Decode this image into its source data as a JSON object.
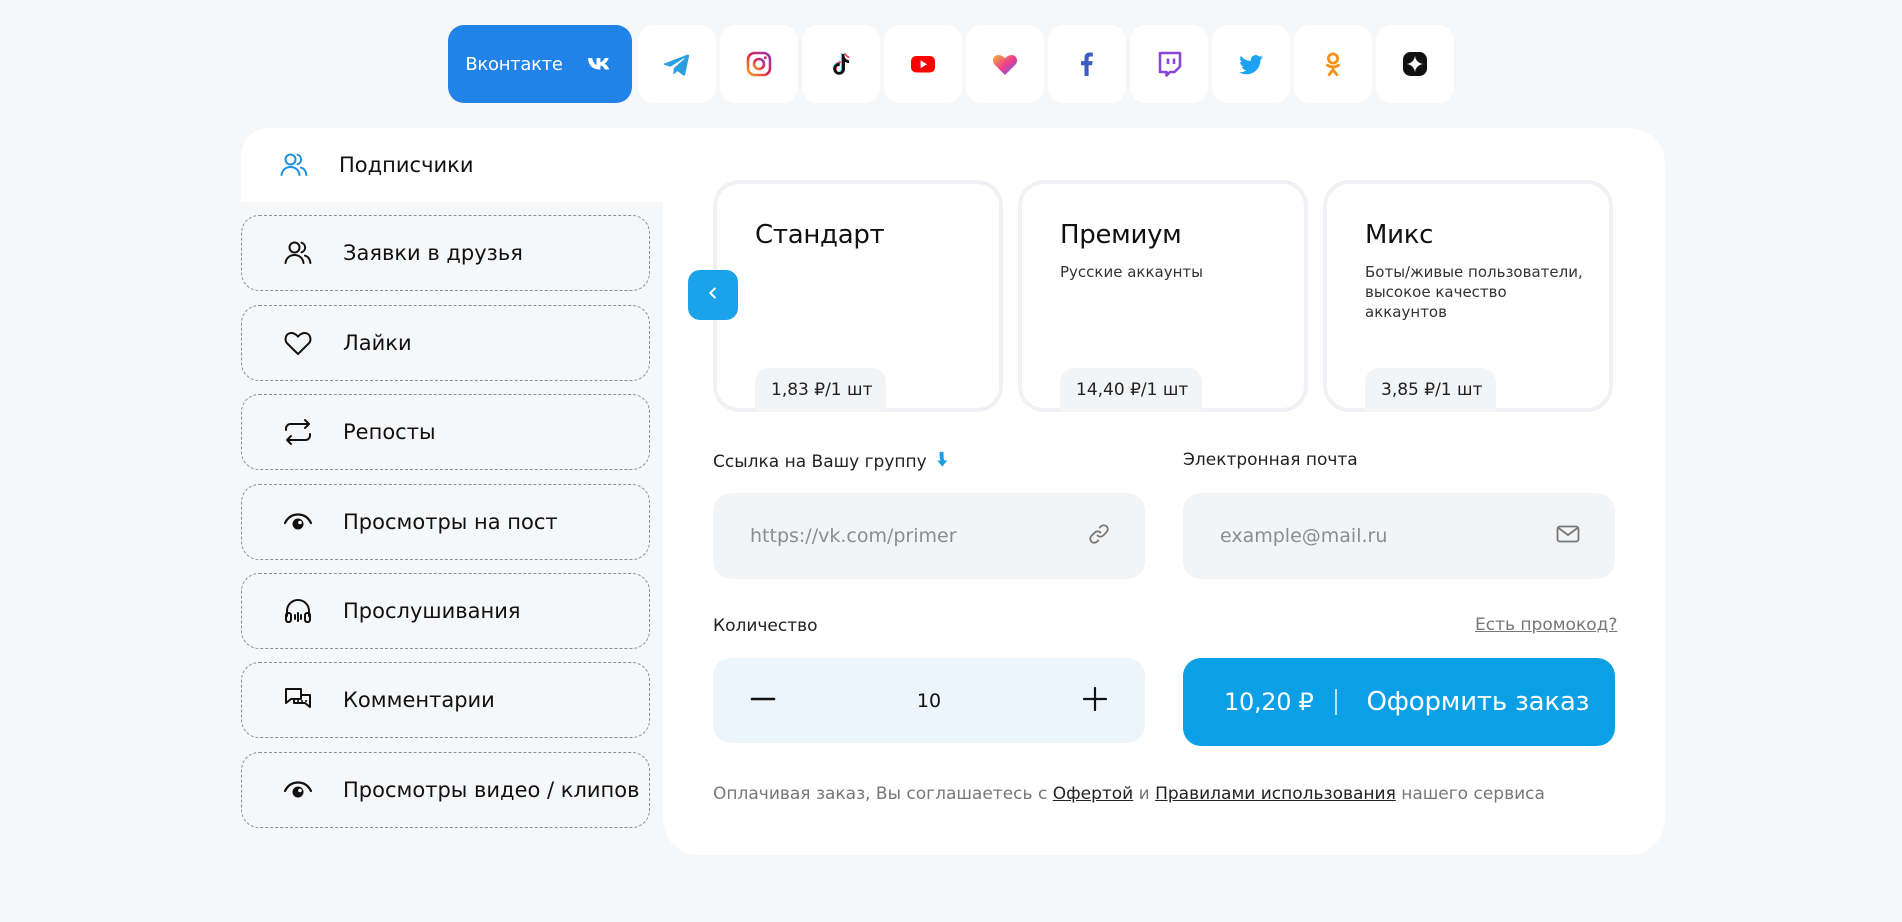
{
  "platforms": {
    "active_label": "Вконтакте",
    "items": [
      "vk",
      "telegram",
      "instagram",
      "tiktok",
      "youtube",
      "likee",
      "facebook",
      "twitch",
      "twitter",
      "odnoklassniki",
      "zen"
    ]
  },
  "sidebar": {
    "items": [
      {
        "label": "Подписчики",
        "icon": "users-icon",
        "active": true
      },
      {
        "label": "Заявки в друзья",
        "icon": "friends-icon"
      },
      {
        "label": "Лайки",
        "icon": "heart-icon"
      },
      {
        "label": "Репосты",
        "icon": "repost-icon"
      },
      {
        "label": "Просмотры на пост",
        "icon": "eye-icon"
      },
      {
        "label": "Прослушивания",
        "icon": "headphones-icon"
      },
      {
        "label": "Комментарии",
        "icon": "comments-icon"
      },
      {
        "label": "Просмотры видео / клипов",
        "icon": "eye-icon"
      }
    ]
  },
  "plans": [
    {
      "name": "Стандарт",
      "desc": "",
      "price": "1,83 ₽/1 шт"
    },
    {
      "name": "Премиум",
      "desc": "Русские аккаунты",
      "price": "14,40 ₽/1 шт"
    },
    {
      "name": "Микс",
      "desc": "Боты/живые пользователи, высокое качество аккаунтов",
      "price": "3,85 ₽/1 шт"
    }
  ],
  "form": {
    "link_label": "Ссылка на Вашу группу",
    "link_placeholder": "https://vk.com/primer",
    "email_label": "Электронная почта",
    "email_placeholder": "example@mail.ru",
    "qty_label": "Количество",
    "promo": "Есть промокод?",
    "qty_value": "10"
  },
  "order": {
    "sum": "10,20 ₽",
    "cta": "Оформить заказ"
  },
  "terms": {
    "prefix": "Оплачивая заказ, Вы соглашаетесь с",
    "offer": "Офертой",
    "and": "и",
    "rules": "Правилами использования",
    "suffix": "нашего сервиса"
  },
  "colors": {
    "accent": "#2183e8",
    "order": "#0ba0e6",
    "page_bg": "#f6f7f9"
  }
}
